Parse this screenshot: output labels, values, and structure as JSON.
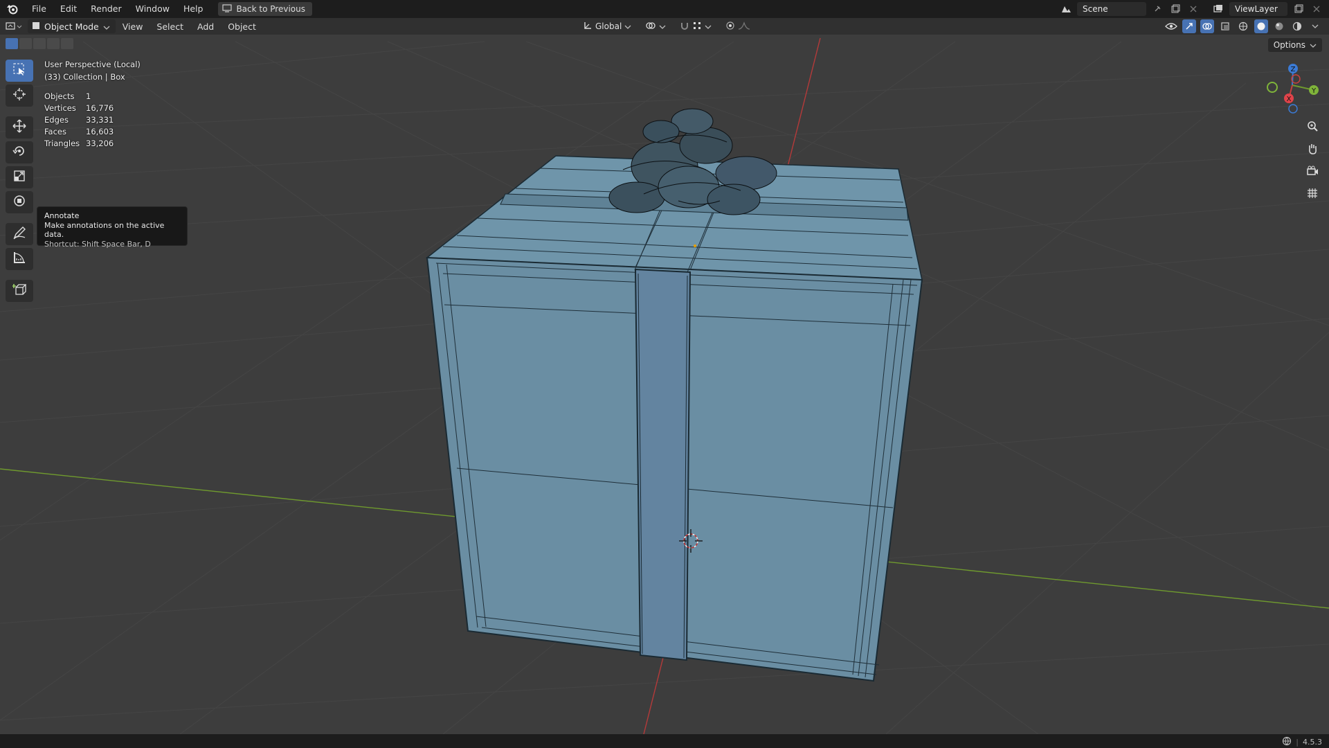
{
  "menu": {
    "file": "File",
    "edit": "Edit",
    "render": "Render",
    "window": "Window",
    "help": "Help",
    "back_to_previous": "Back to Previous"
  },
  "top_right": {
    "scene": "Scene",
    "view_layer": "ViewLayer"
  },
  "header": {
    "mode": "Object Mode",
    "view": "View",
    "select": "Select",
    "add": "Add",
    "object": "Object",
    "transform_orientation": "Global",
    "options": "Options"
  },
  "viewport_info": {
    "perspective": "User Perspective (Local)",
    "collection": "(33) Collection | Box"
  },
  "stats": [
    {
      "label": "Objects",
      "value": "1"
    },
    {
      "label": "Vertices",
      "value": "16,776"
    },
    {
      "label": "Edges",
      "value": "33,331"
    },
    {
      "label": "Faces",
      "value": "16,603"
    },
    {
      "label": "Triangles",
      "value": "33,206"
    }
  ],
  "tooltip": {
    "title": "Annotate",
    "description": "Make annotations on the active data.",
    "shortcut": "Shortcut: Shift Space Bar, D"
  },
  "gizmo": {
    "x": "X",
    "y": "Y",
    "z": "Z"
  },
  "status": {
    "version": "4.5.3"
  },
  "colors": {
    "accent": "#4772b3",
    "box_face": "#6a8ea3",
    "x_axis": "#c8403f",
    "y_axis": "#6f9a2e",
    "z_axis": "#3b7bd6"
  }
}
